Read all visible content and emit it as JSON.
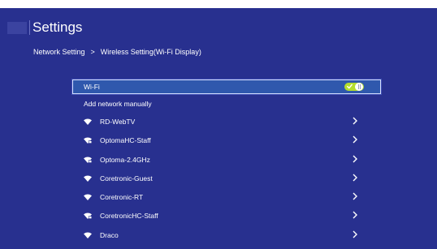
{
  "header": {
    "title": "Settings"
  },
  "breadcrumb": {
    "parent": "Network Setting",
    "separator": ">",
    "current": "Wireless Setting(Wi-Fi Display)"
  },
  "wifi_toggle": {
    "label": "Wi-Fi",
    "state": "on",
    "accent_color": "#b3dd2e"
  },
  "add_network": {
    "label": "Add network manually"
  },
  "networks": [
    {
      "name": "RD-WebTV",
      "icon": "wifi-icon"
    },
    {
      "name": "OptomaHC-Staff",
      "icon": "wifi-secure-icon"
    },
    {
      "name": "Optoma-2.4GHz",
      "icon": "wifi-secure-icon"
    },
    {
      "name": "Coretronic-Guest",
      "icon": "wifi-icon"
    },
    {
      "name": "Coretronic-RT",
      "icon": "wifi-icon"
    },
    {
      "name": "CoretronicHC-Staff",
      "icon": "wifi-secure-icon"
    },
    {
      "name": "Draco",
      "icon": "wifi-icon"
    }
  ],
  "colors": {
    "background": "#28308f",
    "highlight": "#2f58ad",
    "text": "#ffffff"
  }
}
